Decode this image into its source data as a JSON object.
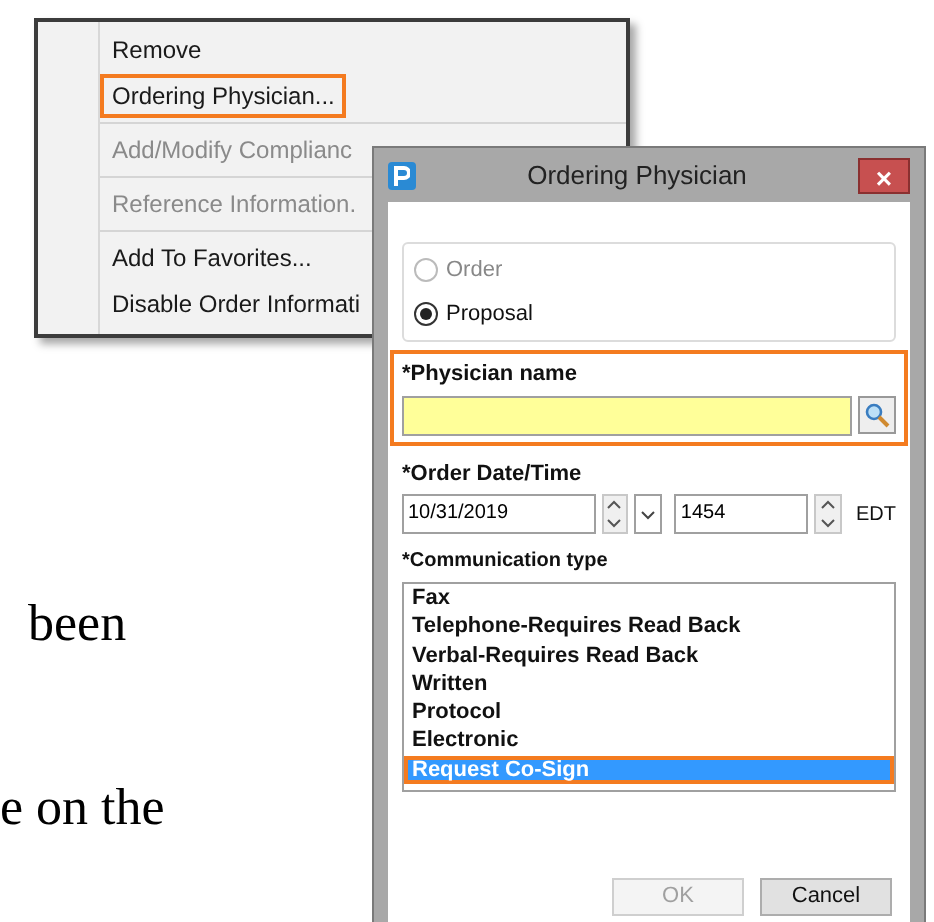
{
  "document": {
    "lines": [
      "been",
      "e on the"
    ]
  },
  "context_menu": {
    "items": [
      {
        "label": "Remove",
        "disabled": false,
        "outlined": false,
        "separator_after": false
      },
      {
        "label": "Ordering Physician...",
        "disabled": false,
        "outlined": true,
        "separator_after": true
      },
      {
        "label": "Add/Modify Complianc",
        "disabled": true,
        "outlined": false,
        "separator_after": true
      },
      {
        "label": "Reference Information.",
        "disabled": true,
        "outlined": false,
        "separator_after": true
      },
      {
        "label": "Add To Favorites...",
        "disabled": false,
        "outlined": false,
        "separator_after": false
      },
      {
        "label": "Disable Order Informati",
        "disabled": false,
        "outlined": false,
        "separator_after": false
      }
    ]
  },
  "dialog": {
    "title": "Ordering Physician",
    "close": "×",
    "radios": [
      {
        "label": "Order",
        "selected": false,
        "disabled": true
      },
      {
        "label": "Proposal",
        "selected": true,
        "disabled": false
      }
    ],
    "physician_name": {
      "label": "*Physician name",
      "outlined": true
    },
    "order_date_time": {
      "label": "*Order Date/Time",
      "date": "10/31/2019",
      "time": "1454",
      "timezone": "EDT"
    },
    "communication_type": {
      "label": "*Communication type",
      "items": [
        {
          "label": "Fax",
          "selected": false,
          "outlined": false
        },
        {
          "label": "Telephone-Requires Read Back",
          "selected": false,
          "outlined": false
        },
        {
          "label": "Verbal-Requires Read Back",
          "selected": false,
          "outlined": false
        },
        {
          "label": "Written",
          "selected": false,
          "outlined": false
        },
        {
          "label": "Protocol",
          "selected": false,
          "outlined": false
        },
        {
          "label": "Electronic",
          "selected": false,
          "outlined": false
        },
        {
          "label": "Request Co-Sign",
          "selected": true,
          "outlined": true
        }
      ]
    },
    "buttons": [
      {
        "label": "OK",
        "disabled": true
      },
      {
        "label": "Cancel",
        "disabled": false
      }
    ]
  }
}
